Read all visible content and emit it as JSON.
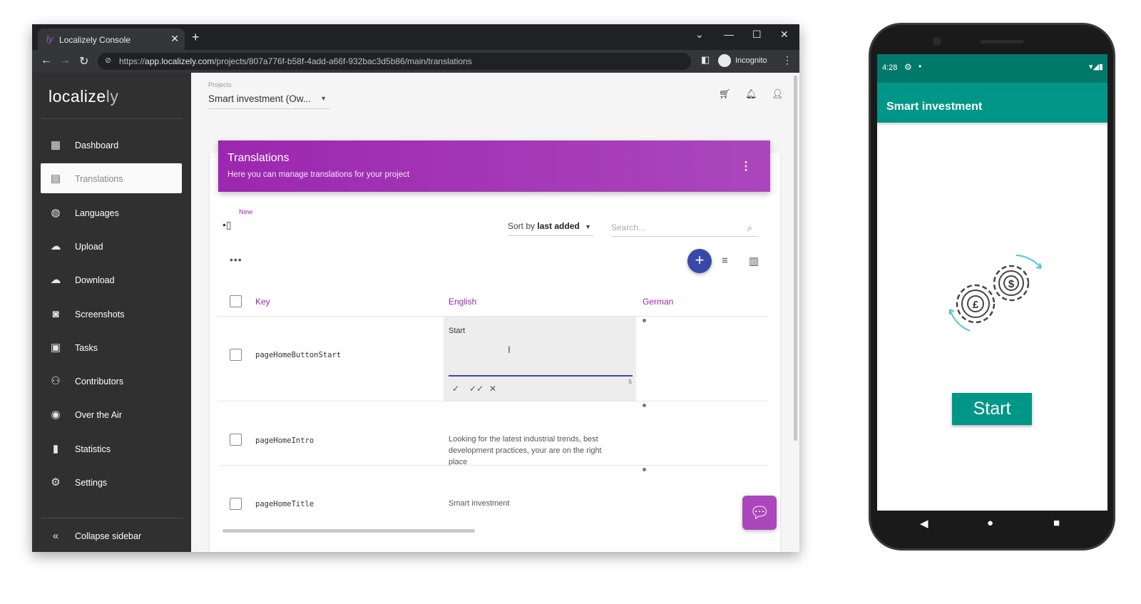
{
  "browser": {
    "tab_title": "Localizely Console",
    "tab_favicon": "ly",
    "url_prefix": "https://",
    "url_host": "app.localizely.com",
    "url_path": "/projects/807a776f-b58f-4add-a66f-932bac3d5b86/main/translations",
    "profile_label": "Incognito"
  },
  "sidebar": {
    "logo_main": "localize",
    "logo_tail": "ly",
    "items": [
      {
        "label": "Dashboard",
        "icon": "dashboard-icon"
      },
      {
        "label": "Translations",
        "icon": "translations-icon"
      },
      {
        "label": "Languages",
        "icon": "globe-icon"
      },
      {
        "label": "Upload",
        "icon": "cloud-upload-icon"
      },
      {
        "label": "Download",
        "icon": "cloud-download-icon"
      },
      {
        "label": "Screenshots",
        "icon": "camera-icon"
      },
      {
        "label": "Tasks",
        "icon": "clipboard-icon"
      },
      {
        "label": "Contributors",
        "icon": "people-icon"
      },
      {
        "label": "Over the Air",
        "icon": "broadcast-icon"
      },
      {
        "label": "Statistics",
        "icon": "bar-chart-icon"
      },
      {
        "label": "Settings",
        "icon": "gear-icon"
      }
    ],
    "collapse_label": "Collapse sidebar"
  },
  "header": {
    "projects_label": "Projects",
    "project_name": "Smart investment (Ow..."
  },
  "banner": {
    "title": "Translations",
    "subtitle": "Here you can manage translations for your project"
  },
  "toolbar": {
    "new_badge": "New",
    "sort_prefix": "Sort by",
    "sort_value": "last added",
    "search_placeholder": "Search..."
  },
  "table": {
    "columns": [
      "Key",
      "English",
      "German"
    ],
    "rows": [
      {
        "key": "pageHomeButtonStart",
        "english": "Start",
        "char_count": "5"
      },
      {
        "key": "pageHomeIntro",
        "english": "Looking for the latest industrial trends, best development practices, your are on the right place"
      },
      {
        "key": "pageHomeTitle",
        "english": "Smart investment"
      }
    ]
  },
  "phone": {
    "time": "4:28",
    "app_title": "Smart investment",
    "button_label": "Start",
    "gear_symbols": [
      "£",
      "$"
    ]
  },
  "colors": {
    "accent_purple": "#9c27b0",
    "fab_blue": "#3949ab",
    "teal": "#009688"
  }
}
